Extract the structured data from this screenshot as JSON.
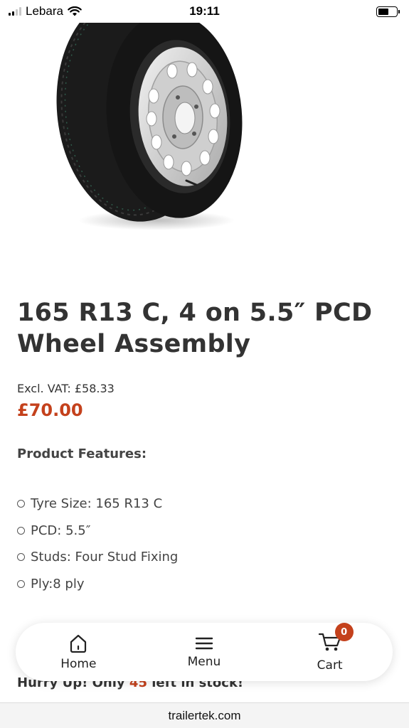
{
  "status_bar": {
    "carrier": "Lebara",
    "time": "19:11",
    "signal_bars": 4,
    "signal_bars_active": 2,
    "battery_level": 0.6
  },
  "product": {
    "image_alt": "wheel-assembly",
    "title": "165 R13 C, 4 on 5.5″ PCD Wheel Assembly",
    "price_excl_vat": "Excl. VAT: £58.33",
    "price": "£70.00",
    "features_heading": "Product Features:",
    "features": [
      "Tyre Size: 165 R13 C",
      "PCD: 5.5″",
      "Studs: Four Stud Fixing",
      "Ply:8 ply"
    ],
    "stock_prefix": "Hurry Up! Only",
    "stock_qty": "45",
    "stock_suffix": "left in stock!"
  },
  "bottom_nav": {
    "home_label": "Home",
    "menu_label": "Menu",
    "cart_label": "Cart",
    "cart_count": "0"
  },
  "browser": {
    "url": "trailertek.com"
  },
  "colors": {
    "accent": "#c4411c",
    "text": "#333333"
  }
}
